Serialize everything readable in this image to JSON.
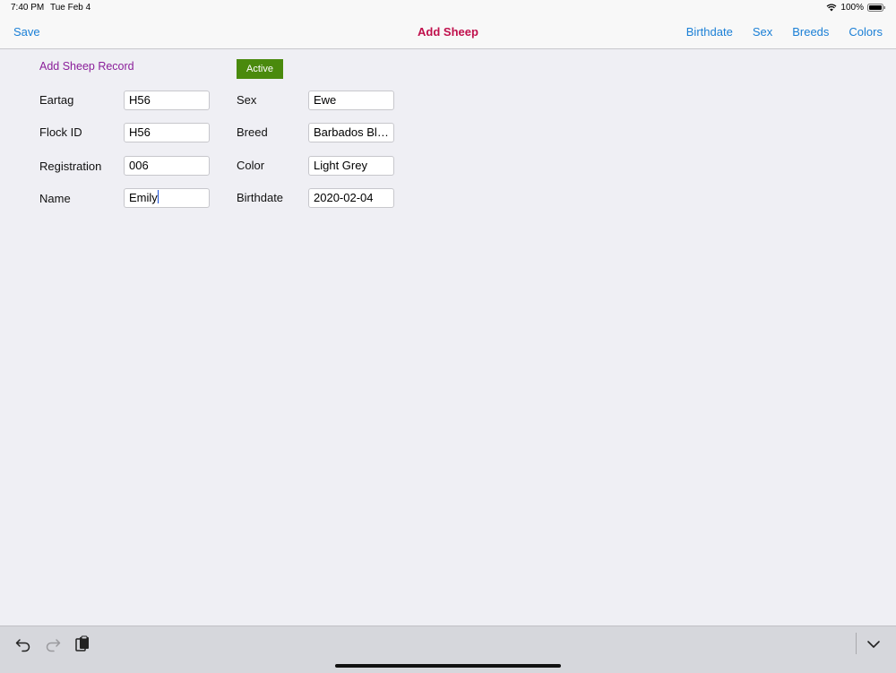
{
  "status": {
    "time": "7:40 PM",
    "date": "Tue Feb 4",
    "battery": "100%"
  },
  "nav": {
    "save_label": "Save",
    "title": "Add Sheep",
    "actions": [
      "Birthdate",
      "Sex",
      "Breeds",
      "Colors"
    ]
  },
  "form": {
    "section_title": "Add Sheep Record",
    "status_label": "Active",
    "eartag": {
      "label": "Eartag",
      "value": "H56"
    },
    "flock_id": {
      "label": "Flock ID",
      "value": "H56"
    },
    "registration": {
      "label": "Registration",
      "value": "006"
    },
    "name": {
      "label": "Name",
      "value": "Emily"
    },
    "sex": {
      "label": "Sex",
      "value": "Ewe"
    },
    "breed": {
      "label": "Breed",
      "value": "Barbados Black Belly"
    },
    "color": {
      "label": "Color",
      "value": "Light Grey"
    },
    "birthdate": {
      "label": "Birthdate",
      "value": "2020-02-04"
    }
  },
  "keyboard": {
    "icons": [
      "undo-icon",
      "redo-icon",
      "paste-icon",
      "dismiss-keyboard-icon"
    ]
  },
  "colors": {
    "accent": "#1a7fd6",
    "title": "#c0104c",
    "section": "#8b1f9a",
    "active": "#4a8a0d"
  }
}
